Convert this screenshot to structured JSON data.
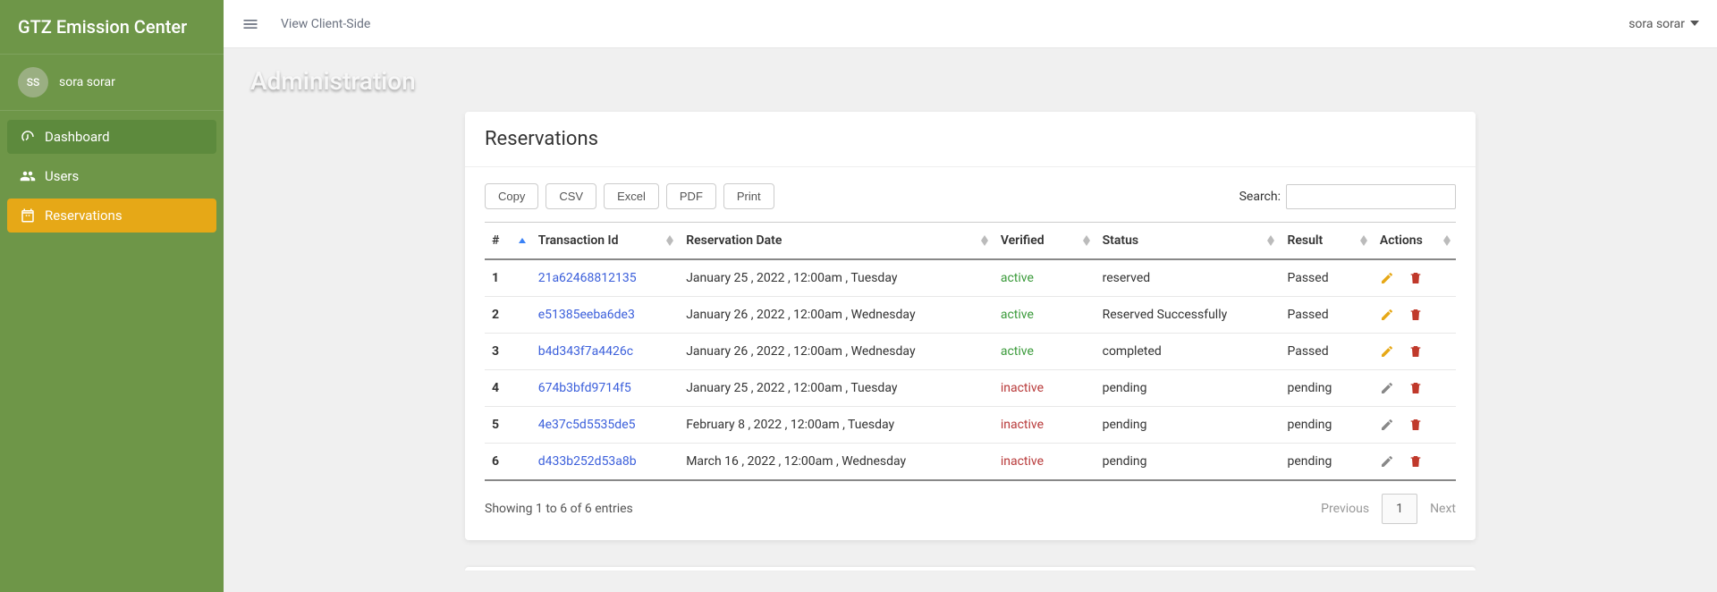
{
  "brand": "GTZ Emission Center",
  "user": {
    "initials": "SS",
    "name": "sora sorar"
  },
  "sidebar": {
    "items": [
      {
        "label": "Dashboard",
        "style": "green",
        "icon": "gauge-icon"
      },
      {
        "label": "Users",
        "style": "plain",
        "icon": "users-icon"
      },
      {
        "label": "Reservations",
        "style": "active",
        "icon": "calendar-icon"
      }
    ]
  },
  "topbar": {
    "view_client_label": "View Client-Side",
    "user_name": "sora sorar"
  },
  "page_title": "Administration",
  "card": {
    "title": "Reservations",
    "buttons": {
      "copy": "Copy",
      "csv": "CSV",
      "excel": "Excel",
      "pdf": "PDF",
      "print": "Print"
    },
    "search_label": "Search:",
    "columns": {
      "num": "#",
      "txn": "Transaction Id",
      "date": "Reservation Date",
      "verified": "Verified",
      "status": "Status",
      "result": "Result",
      "actions": "Actions"
    },
    "rows": [
      {
        "n": "1",
        "txn": "21a62468812135",
        "date": "January 25 , 2022 , 12:00am , Tuesday",
        "verified": "active",
        "status": "reserved",
        "result": "Passed",
        "edit": "orange"
      },
      {
        "n": "2",
        "txn": "e51385eeba6de3",
        "date": "January 26 , 2022 , 12:00am , Wednesday",
        "verified": "active",
        "status": "Reserved Successfully",
        "result": "Passed",
        "edit": "orange"
      },
      {
        "n": "3",
        "txn": "b4d343f7a4426c",
        "date": "January 26 , 2022 , 12:00am , Wednesday",
        "verified": "active",
        "status": "completed",
        "result": "Passed",
        "edit": "orange"
      },
      {
        "n": "4",
        "txn": "674b3bfd9714f5",
        "date": "January 25 , 2022 , 12:00am , Tuesday",
        "verified": "inactive",
        "status": "pending",
        "result": "pending",
        "edit": "gray"
      },
      {
        "n": "5",
        "txn": "4e37c5d5535de5",
        "date": "February 8 , 2022 , 12:00am , Tuesday",
        "verified": "inactive",
        "status": "pending",
        "result": "pending",
        "edit": "gray"
      },
      {
        "n": "6",
        "txn": "d433b252d53a8b",
        "date": "March 16 , 2022 , 12:00am , Wednesday",
        "verified": "inactive",
        "status": "pending",
        "result": "pending",
        "edit": "gray"
      }
    ],
    "footer_text": "Showing 1 to 6 of 6 entries",
    "pagination": {
      "prev": "Previous",
      "page": "1",
      "next": "Next"
    }
  }
}
